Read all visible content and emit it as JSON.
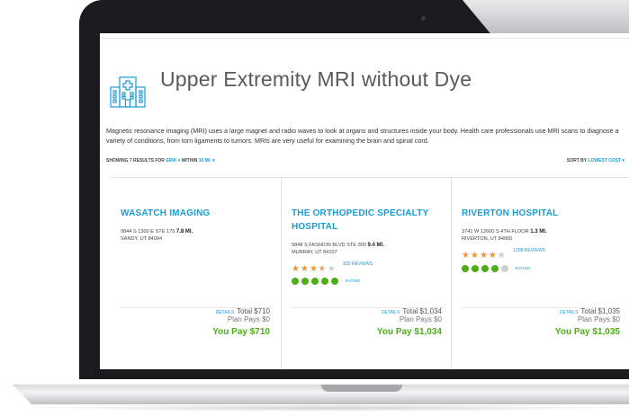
{
  "page": {
    "title": "Upper Extremity MRI without Dye",
    "description": "Magnetic resonance imaging (MRI) uses a large magnet and radio waves to look at organs and structures inside your body. Health care professionals use MRI scans to diagnose a variety of conditions, from torn ligaments to tumors. MRIs are very useful for examining the brain and spinal cord."
  },
  "filter": {
    "prefix": "SHOWING 7 RESULTS FOR",
    "location": "ERIK",
    "within_label": "WITHIN",
    "distance": "15 MI."
  },
  "sort": {
    "label": "SORT BY",
    "value": "LOWEST COST"
  },
  "colors": {
    "accent": "#1a9bd7",
    "pay_green": "#4caf14",
    "star_orange": "#e8963a"
  },
  "icons": {
    "hospital": "hospital-building-icon",
    "dropdown": "chevron-down-icon",
    "star": "star-icon",
    "rating_dot": "circle-icon"
  },
  "results": [
    {
      "name": "WASATCH IMAGING",
      "address1": "9844 S 1300 E STE 175",
      "distance": "7.8 MI.",
      "address2": "SANDY, UT 84094",
      "stars": null,
      "reviews": "",
      "rating_dots": null,
      "rating_label": "",
      "details_label": "DETAILS",
      "total": "Total $710",
      "plan_pays": "Plan Pays $0",
      "you_pay": "You Pay $710"
    },
    {
      "name": "THE ORTHOPEDIC SPECIALTY HOSPITAL",
      "address1": "5848 S FASHION BLVD STE 300",
      "distance": "9.4 MI.",
      "address2": "MURRAY, UT 84107",
      "stars": 3.5,
      "reviews": "830 REVIEWS",
      "rating_dots": 5,
      "rating_label": "RATING",
      "details_label": "DETAILS",
      "total": "Total $1,034",
      "plan_pays": "Plan Pays $0",
      "you_pay": "You Pay $1,034"
    },
    {
      "name": "RIVERTON HOSPITAL",
      "address1": "3741 W 12600 S 4TH FLOOR",
      "distance": "1.3 MI.",
      "address2": "RIVERTON, UT 84065",
      "stars": 4,
      "reviews": "1298 REVIEWS",
      "rating_dots": 4,
      "rating_label": "RATING",
      "details_label": "DETAILS",
      "total": "Total $1,035",
      "plan_pays": "Plan Pays $0",
      "you_pay": "You Pay $1,035"
    }
  ]
}
